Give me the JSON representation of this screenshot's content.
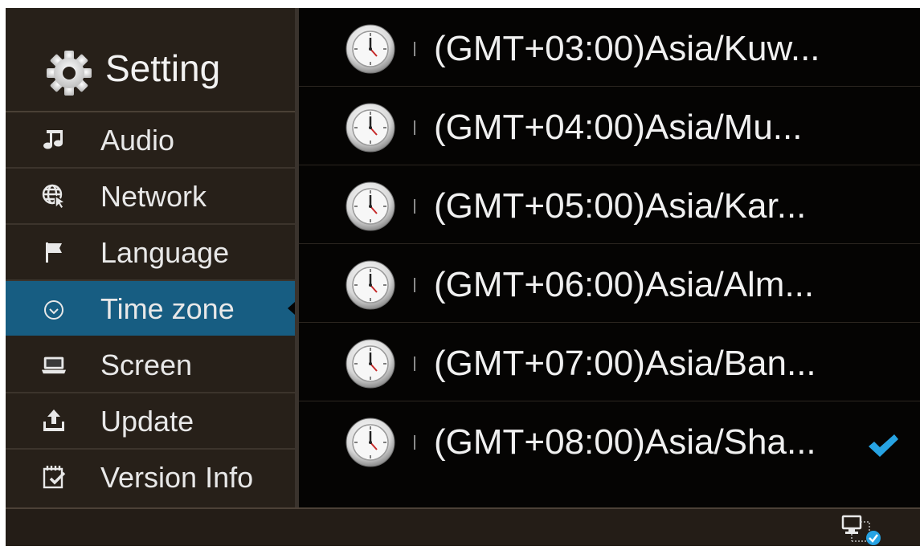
{
  "sidebar": {
    "title": "Setting",
    "title_icon": "gear-icon",
    "items": [
      {
        "label": "Audio",
        "icon": "music-note-icon",
        "active": false
      },
      {
        "label": "Network",
        "icon": "globe-cursor-icon",
        "active": false
      },
      {
        "label": "Language",
        "icon": "flag-icon",
        "active": false
      },
      {
        "label": "Time zone",
        "icon": "clock-outline-icon",
        "active": true
      },
      {
        "label": "Screen",
        "icon": "laptop-icon",
        "active": false
      },
      {
        "label": "Update",
        "icon": "upload-icon",
        "active": false
      },
      {
        "label": "Version Info",
        "icon": "notepad-check-icon",
        "active": false
      }
    ]
  },
  "timezones": [
    {
      "label": "(GMT+03:00)Asia/Kuw...",
      "selected": false
    },
    {
      "label": "(GMT+04:00)Asia/Mu...",
      "selected": false
    },
    {
      "label": "(GMT+05:00)Asia/Kar...",
      "selected": false
    },
    {
      "label": "(GMT+06:00)Asia/Alm...",
      "selected": false
    },
    {
      "label": "(GMT+07:00)Asia/Ban...",
      "selected": false
    },
    {
      "label": "(GMT+08:00)Asia/Sha...",
      "selected": true
    }
  ],
  "footer": {
    "status_icon": "network-connected-icon"
  },
  "colors": {
    "active_bg": "#175d82",
    "check": "#27a3e3",
    "sidebar_bg": "#272019",
    "list_bg": "#050403"
  }
}
